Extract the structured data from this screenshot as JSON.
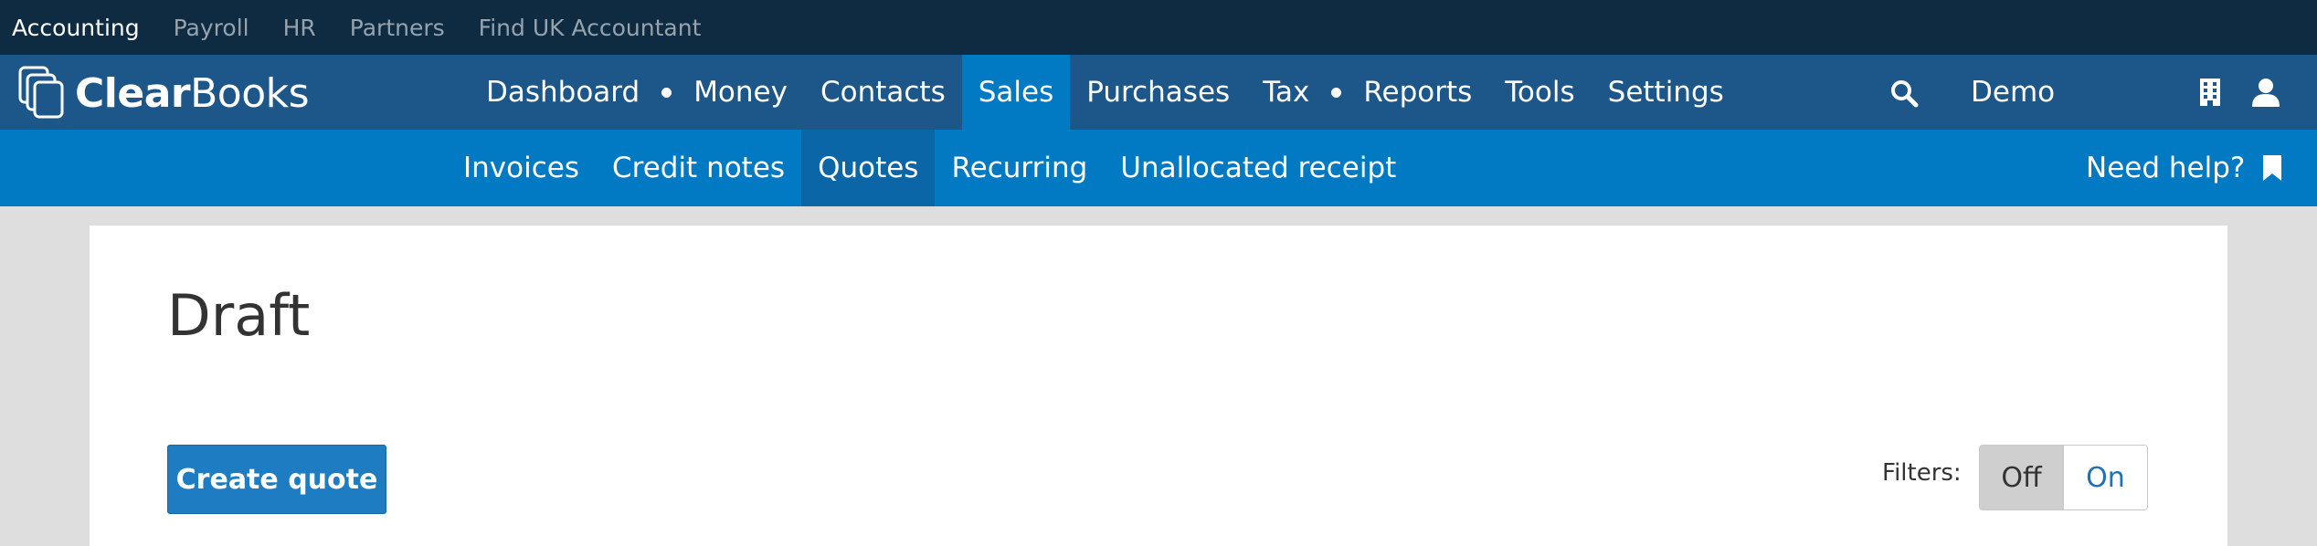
{
  "topbar": {
    "items": [
      {
        "label": "Accounting",
        "active": true
      },
      {
        "label": "Payroll",
        "active": false
      },
      {
        "label": "HR",
        "active": false
      },
      {
        "label": "Partners",
        "active": false
      },
      {
        "label": "Find UK Accountant",
        "active": false
      }
    ]
  },
  "brand": {
    "bold": "Clear",
    "regular": "Books"
  },
  "mainnav": {
    "items": [
      "Dashboard",
      "Money",
      "Contacts",
      "Sales",
      "Purchases",
      "Tax",
      "Reports",
      "Tools",
      "Settings"
    ],
    "active": "Sales",
    "company": "Demo"
  },
  "subnav": {
    "items": [
      "Invoices",
      "Credit notes",
      "Quotes",
      "Recurring",
      "Unallocated receipt"
    ],
    "active": "Quotes",
    "help": "Need help?"
  },
  "page": {
    "title": "Draft",
    "create_button": "Create quote",
    "filters_label": "Filters:",
    "filter_off": "Off",
    "filter_on": "On"
  },
  "colors": {
    "topbar_bg": "#0e2b42",
    "mainnav_bg": "#1d5688",
    "subnav_bg": "#0179c3",
    "button_bg": "#1d7cc2"
  },
  "icons": [
    "logo-stack-icon",
    "search-icon",
    "building-icon",
    "user-icon",
    "bookmark-icon"
  ]
}
